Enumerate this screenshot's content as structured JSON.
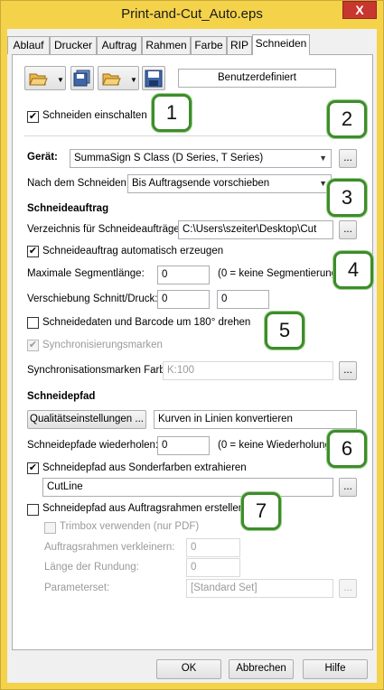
{
  "window": {
    "title": "Print-and-Cut_Auto.eps",
    "close": "X"
  },
  "tabs": [
    "Ablauf",
    "Drucker",
    "Auftrag",
    "Rahmen",
    "Farbe",
    "RIP",
    "Schneiden"
  ],
  "toolbar": {
    "preset_label": "Benutzerdefiniert"
  },
  "enable_cut": {
    "label": "Schneiden einschalten",
    "checked": true
  },
  "device": {
    "label": "Gerät:",
    "value": "SummaSign S Class (D Series, T Series)",
    "more": "..."
  },
  "after_cut": {
    "label": "Nach dem Schneiden:",
    "value": "Bis Auftragsende vorschieben"
  },
  "cut_job": {
    "heading": "Schneideauftrag",
    "folder_label": "Verzeichnis für Schneideaufträge:",
    "folder_value": "C:\\Users\\szeiter\\Desktop\\Cut",
    "auto_label": "Schneideauftrag automatisch erzeugen",
    "max_seg_label": "Maximale Segmentlänge:",
    "max_seg_value": "0",
    "max_seg_hint": "(0 = keine Segmentierung)",
    "offset_label": "Verschiebung Schnitt/Druck:",
    "offset_x": "0",
    "offset_y": "0",
    "rotate_label": "Schneidedaten und Barcode um 180° drehen",
    "sync_label": "Synchronisierungsmarken",
    "sync_color_label": "Synchronisationsmarken Farbe",
    "sync_color_value": "K:100"
  },
  "cut_path": {
    "heading": "Schneidepfad",
    "quality_btn": "Qualitätseinstellungen ...",
    "convert_value": "Kurven in Linien konvertieren",
    "repeat_label": "Schneidepfade wiederholen:",
    "repeat_value": "0",
    "repeat_hint": "(0 = keine Wiederholung)",
    "spot_label": "Schneidepfad aus Sonderfarben extrahieren",
    "spot_value": "CutLine",
    "frame_label": "Schneidepfad aus Auftragsrahmen erstellen",
    "trimbox_label": "Trimbox verwenden (nur PDF)",
    "shrink_label": "Auftragsrahmen verkleinern:",
    "shrink_value": "0",
    "round_label": "Länge der Rundung:",
    "round_value": "0",
    "paramset_label": "Parameterset:",
    "paramset_value": "[Standard Set]"
  },
  "footer": {
    "ok": "OK",
    "cancel": "Abbrechen",
    "help": "Hilfe"
  },
  "callouts": [
    "1",
    "2",
    "3",
    "4",
    "5",
    "6",
    "7"
  ],
  "colors": {
    "callout_border": "#3e8c2c",
    "window_frame": "#f4d34a",
    "close_button": "#c7372f"
  }
}
